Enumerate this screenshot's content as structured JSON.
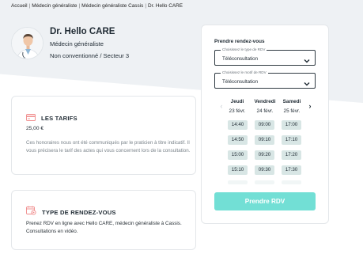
{
  "breadcrumb": [
    "Accueil",
    "Médecin généraliste",
    "Médecin généraliste Cassis",
    "Dr. Hello CARE"
  ],
  "profile": {
    "name": "Dr. Hello CARE",
    "specialty": "Médecin généraliste",
    "sector": "Non conventionné / Secteur 3"
  },
  "tarifs": {
    "title": "LES TARIFS",
    "price": "25,00 €",
    "note": "Ces honoraires nous ont été communiqués par le praticien à titre indicatif. Il vous précisera le tarif des actes qui vous concernent lors de la consultation."
  },
  "type_rdv": {
    "title": "TYPE DE RENDEZ-VOUS",
    "description": "Prenez RDV en ligne avec Hello CARE, médecin généraliste à Cassis. Consultations en vidéo."
  },
  "booking": {
    "title": "Prendre rendez-vous",
    "type_select": {
      "label": "Choisissez le type de RDV",
      "value": "Téléconsultation"
    },
    "motif_select": {
      "label": "Choisissez le motif de RDV",
      "value": "Téléconsultation"
    },
    "days": [
      {
        "name": "Jeudi",
        "date": "23 févr.",
        "slots": [
          "14:40",
          "14:50",
          "15:00",
          "15:10"
        ]
      },
      {
        "name": "Vendredi",
        "date": "24 févr.",
        "slots": [
          "09:00",
          "09:10",
          "09:20",
          "09:30"
        ]
      },
      {
        "name": "Samedi",
        "date": "25 févr.",
        "slots": [
          "17:00",
          "17:10",
          "17:20",
          "17:30"
        ]
      }
    ],
    "cta": "Prendre RDV"
  },
  "colors": {
    "accent": "#72dfd5",
    "slot_bg": "#d8e6e5",
    "tarif_icon": "#f08a8a"
  }
}
